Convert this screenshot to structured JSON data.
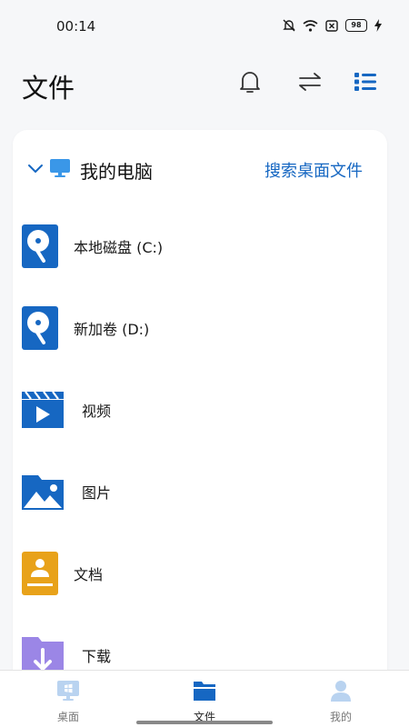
{
  "status_bar": {
    "time": "00:14",
    "battery": "98"
  },
  "header": {
    "title": "文件"
  },
  "card": {
    "title": "我的电脑",
    "search_link": "搜索桌面文件",
    "items": [
      {
        "label": "本地磁盘 (C:)",
        "icon": "disk-icon"
      },
      {
        "label": "新加卷 (D:)",
        "icon": "disk-icon"
      },
      {
        "label": "视频",
        "icon": "video-folder-icon"
      },
      {
        "label": "图片",
        "icon": "image-folder-icon"
      },
      {
        "label": "文档",
        "icon": "document-icon"
      },
      {
        "label": "下载",
        "icon": "download-folder-icon"
      }
    ]
  },
  "bottom_nav": {
    "items": [
      {
        "label": "桌面"
      },
      {
        "label": "文件"
      },
      {
        "label": "我的"
      }
    ],
    "active": "文件"
  },
  "colors": {
    "accent": "#1667c2",
    "doc": "#e8a21a",
    "download": "#9b86e6"
  }
}
